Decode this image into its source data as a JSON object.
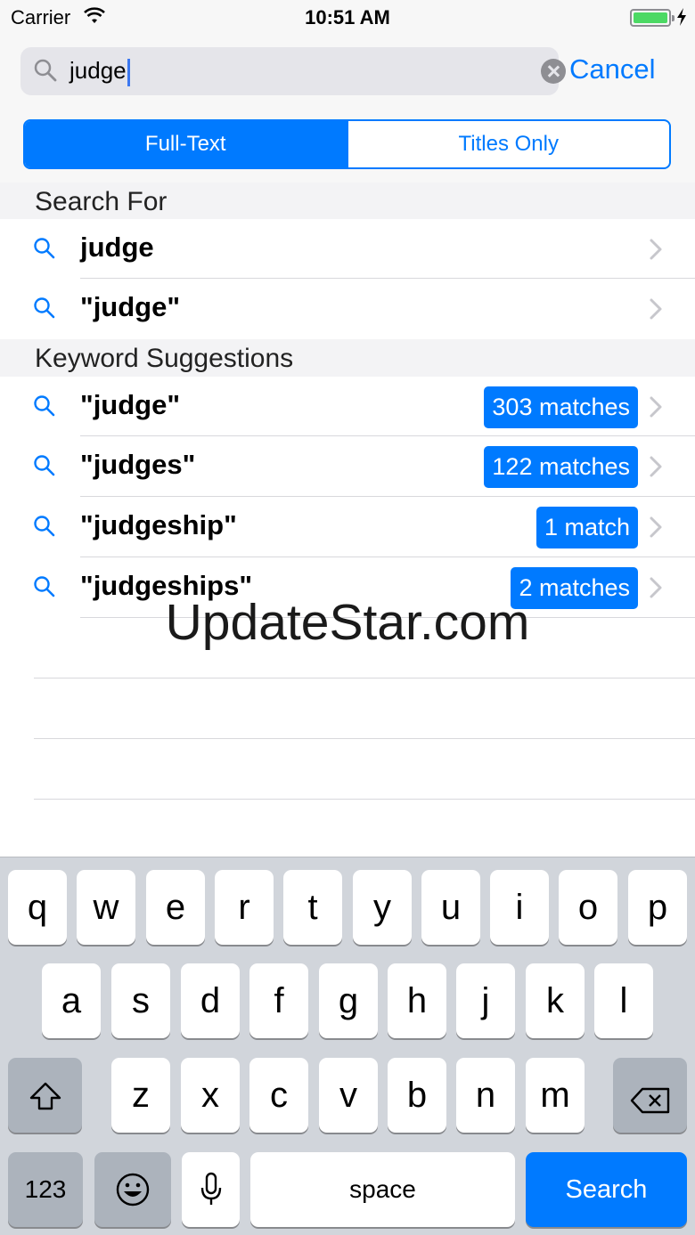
{
  "status_bar": {
    "carrier": "Carrier",
    "time": "10:51 AM"
  },
  "search": {
    "value": "judge",
    "cancel_label": "Cancel"
  },
  "scope": {
    "options": [
      "Full-Text",
      "Titles Only"
    ],
    "selected": "Full-Text"
  },
  "sections": {
    "search_for": {
      "title": "Search For",
      "items": [
        {
          "label": "judge"
        },
        {
          "label": "\"judge\""
        }
      ]
    },
    "keyword_suggestions": {
      "title": "Keyword Suggestions",
      "items": [
        {
          "label": "\"judge\"",
          "matches": "303 matches"
        },
        {
          "label": "\"judges\"",
          "matches": "122 matches"
        },
        {
          "label": "\"judgeship\"",
          "matches": "1 match"
        },
        {
          "label": "\"judgeships\"",
          "matches": "2 matches"
        }
      ]
    }
  },
  "watermark": "UpdateStar.com",
  "keyboard": {
    "row1": [
      "q",
      "w",
      "e",
      "r",
      "t",
      "y",
      "u",
      "i",
      "o",
      "p"
    ],
    "row2": [
      "a",
      "s",
      "d",
      "f",
      "g",
      "h",
      "j",
      "k",
      "l"
    ],
    "row3": [
      "z",
      "x",
      "c",
      "v",
      "b",
      "n",
      "m"
    ],
    "numbers_label": "123",
    "space_label": "space",
    "search_label": "Search"
  },
  "colors": {
    "accent": "#007aff",
    "battery": "#4cd964"
  },
  "icons": [
    "wifi-icon",
    "battery-icon",
    "charging-icon",
    "search-icon",
    "clear-icon",
    "chevron-right-icon",
    "shift-icon",
    "delete-icon",
    "emoji-icon",
    "microphone-icon"
  ]
}
